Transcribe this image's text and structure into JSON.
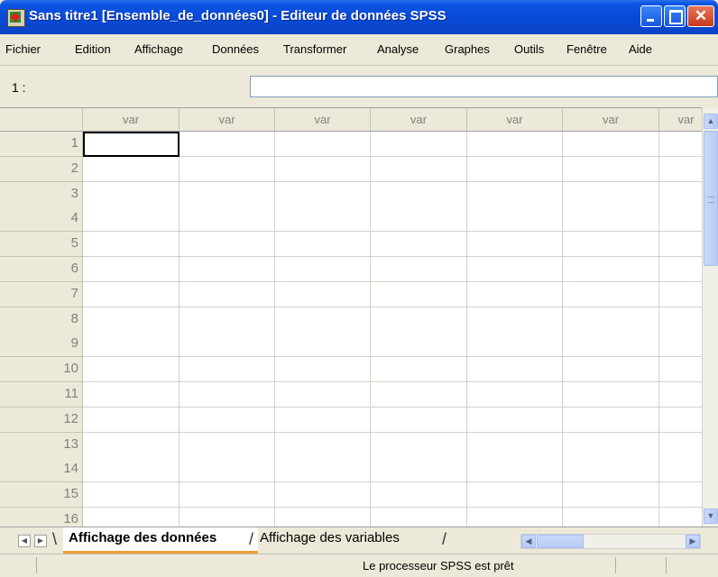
{
  "window": {
    "title": "Sans titre1 [Ensemble_de_données0] - Editeur de données SPSS"
  },
  "menu": [
    "Fichier",
    "Edition",
    "Affichage",
    "Données",
    "Transformer",
    "Analyse",
    "Graphes",
    "Outils",
    "Fenêtre",
    "Aide"
  ],
  "cellref": {
    "label": "1 :",
    "value": ""
  },
  "grid": {
    "column_headers": [
      "var",
      "var",
      "var",
      "var",
      "var",
      "var",
      "var"
    ],
    "row_numbers": [
      "1",
      "2",
      "3",
      "4",
      "5",
      "6",
      "7",
      "8",
      "9",
      "10",
      "11",
      "12",
      "13",
      "14",
      "15",
      "16"
    ],
    "active_cell": {
      "row": 1,
      "col": 1
    }
  },
  "tabs": {
    "data_view": "Affichage des données",
    "variable_view": "Affichage des variables"
  },
  "status": {
    "message": "Le processeur SPSS est prêt"
  }
}
